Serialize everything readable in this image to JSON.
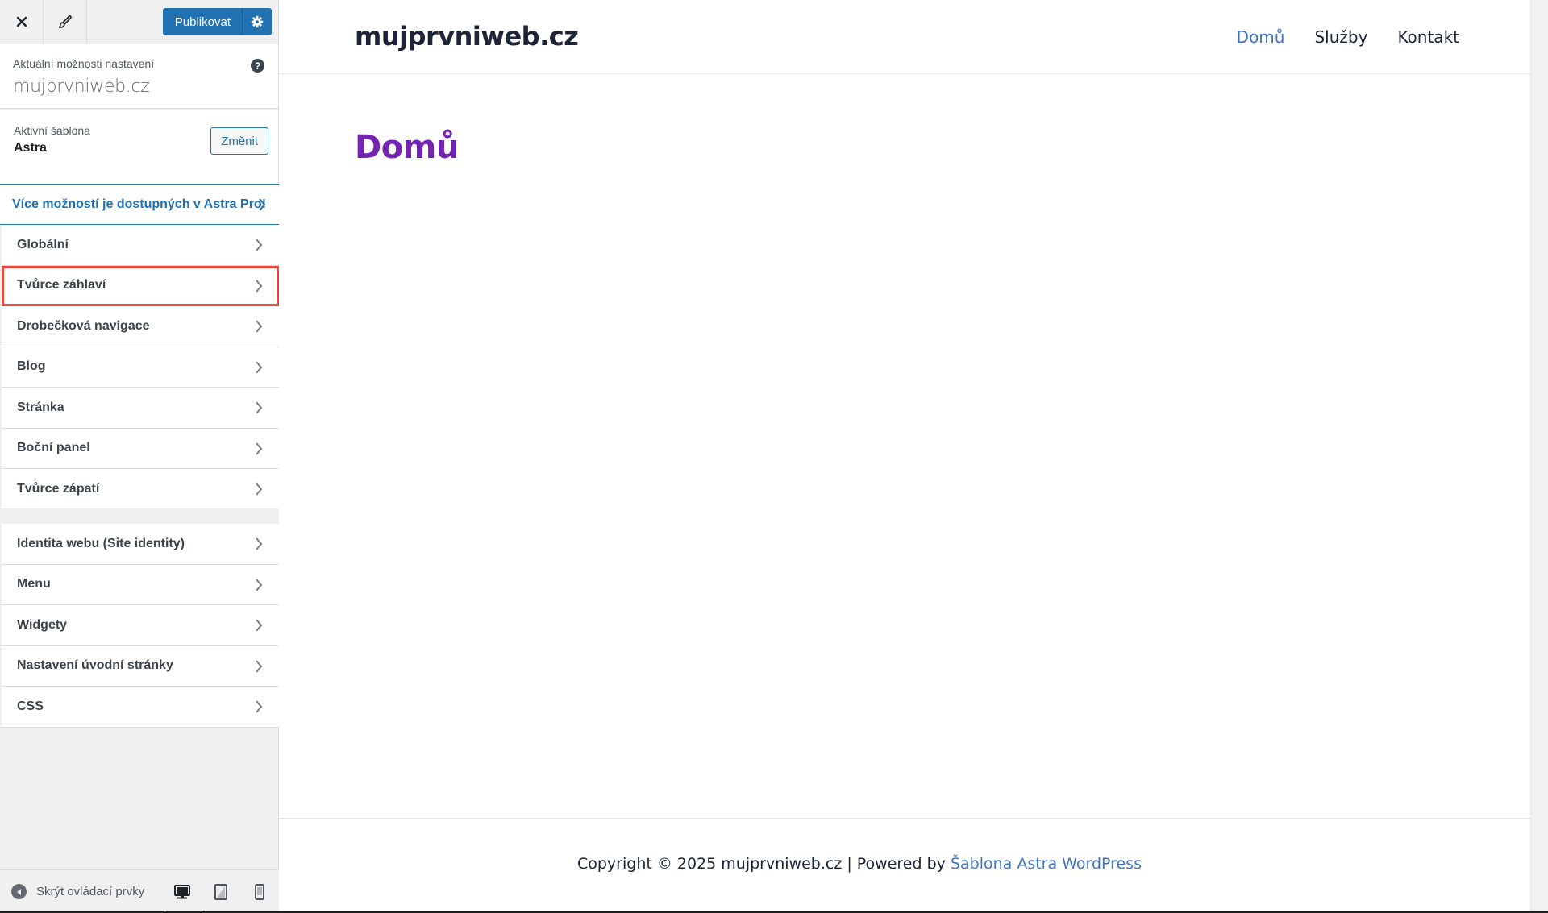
{
  "topbar": {
    "close_icon": "close-icon",
    "brush_icon": "brush-icon",
    "publish_label": "Publikovat",
    "publish_gear_icon": "gear-icon"
  },
  "info": {
    "caption": "Aktuální možnosti nastavení",
    "site_name": "mujprvniweb.cz",
    "help_icon": "?"
  },
  "theme": {
    "caption": "Aktivní šablona",
    "name": "Astra",
    "change_label": "Změnit"
  },
  "pro_link": "Více možností je dostupných v Astra Pro!",
  "sections_a": [
    {
      "label": "Globální"
    },
    {
      "label": "Tvůrce záhlaví",
      "highlighted": true
    },
    {
      "label": "Drobečková navigace"
    },
    {
      "label": "Blog"
    },
    {
      "label": "Stránka"
    },
    {
      "label": "Boční panel"
    },
    {
      "label": "Tvůrce zápatí"
    }
  ],
  "sections_b": [
    {
      "label": "Identita webu (Site identity)"
    },
    {
      "label": "Menu"
    },
    {
      "label": "Widgety"
    },
    {
      "label": "Nastavení úvodní stránky"
    },
    {
      "label": "CSS"
    }
  ],
  "footer_bar": {
    "collapse_label": "Skrýt ovládací prvky",
    "devices": [
      "desktop",
      "tablet",
      "mobile"
    ],
    "active_device": "desktop"
  },
  "preview": {
    "site_title": "mujprvniweb.cz",
    "nav": [
      "Domů",
      "Služby",
      "Kontakt"
    ],
    "nav_current": "Domů",
    "page_heading": "Domů",
    "footer_text": "Copyright © 2025 mujprvniweb.cz | Powered by ",
    "footer_link": "Šablona Astra WordPress"
  },
  "colors": {
    "accent": "#2271b1",
    "heading": "#7324b2",
    "nav_current": "#3f73c4",
    "highlight": "#e5483a"
  }
}
